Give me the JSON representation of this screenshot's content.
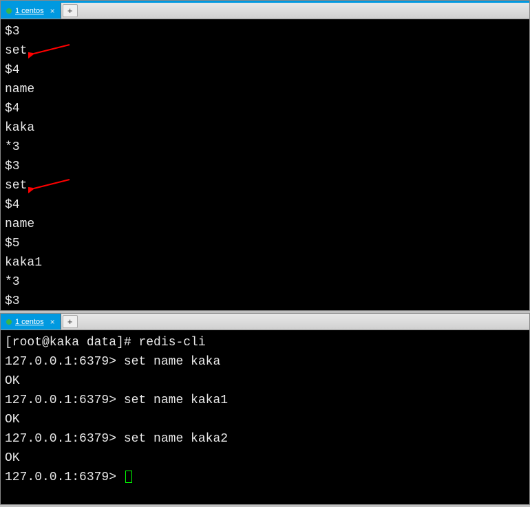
{
  "topTerminal": {
    "tab": {
      "label": "1 centos",
      "closeGlyph": "×"
    },
    "addTabGlyph": "+",
    "lines": [
      "$3",
      "set",
      "$4",
      "name",
      "$4",
      "kaka",
      "*3",
      "$3",
      "set",
      "$4",
      "name",
      "$5",
      "kaka1",
      "*3",
      "$3"
    ],
    "annotatedLineIndexes": [
      1,
      8
    ]
  },
  "bottomTerminal": {
    "tab": {
      "label": "1 centos",
      "closeGlyph": "×"
    },
    "addTabGlyph": "+",
    "shellPrompt": "[root@kaka data]# ",
    "shellCommand": "redis-cli",
    "redisPrompt": "127.0.0.1:6379> ",
    "interactions": [
      {
        "cmd": "set name kaka",
        "resp": "OK"
      },
      {
        "cmd": "set name kaka1",
        "resp": "OK"
      },
      {
        "cmd": "set name kaka2",
        "resp": "OK"
      }
    ]
  }
}
